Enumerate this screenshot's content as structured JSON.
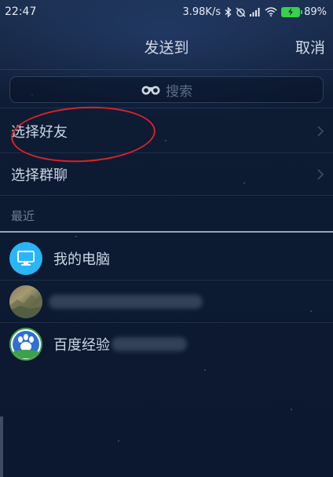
{
  "status_bar": {
    "time": "22:47",
    "network_speed": "3.98K/s",
    "battery_percent": "89%",
    "icons": [
      "bluetooth-icon",
      "alarm-off-icon",
      "signal-icon",
      "wifi-icon",
      "battery-charging-icon"
    ]
  },
  "header": {
    "title": "发送到",
    "cancel_label": "取消"
  },
  "search": {
    "icon": "binoculars-icon",
    "placeholder": "搜索"
  },
  "menu": {
    "items": [
      {
        "label": "选择好友",
        "icon": "chevron-right-icon"
      },
      {
        "label": "选择群聊",
        "icon": "chevron-right-icon"
      }
    ]
  },
  "recent": {
    "section_label": "最近",
    "contacts": [
      {
        "name": "我的电脑",
        "avatar": "computer-icon",
        "avatar_color": "#29b6f6"
      },
      {
        "name": "",
        "avatar": "photo-avatar",
        "blurred": true
      },
      {
        "name": "百度经验",
        "avatar": "baidu-paw-avatar",
        "blurred_suffix": true
      }
    ]
  },
  "annotation": {
    "type": "red-oval",
    "color": "#d8222b"
  }
}
